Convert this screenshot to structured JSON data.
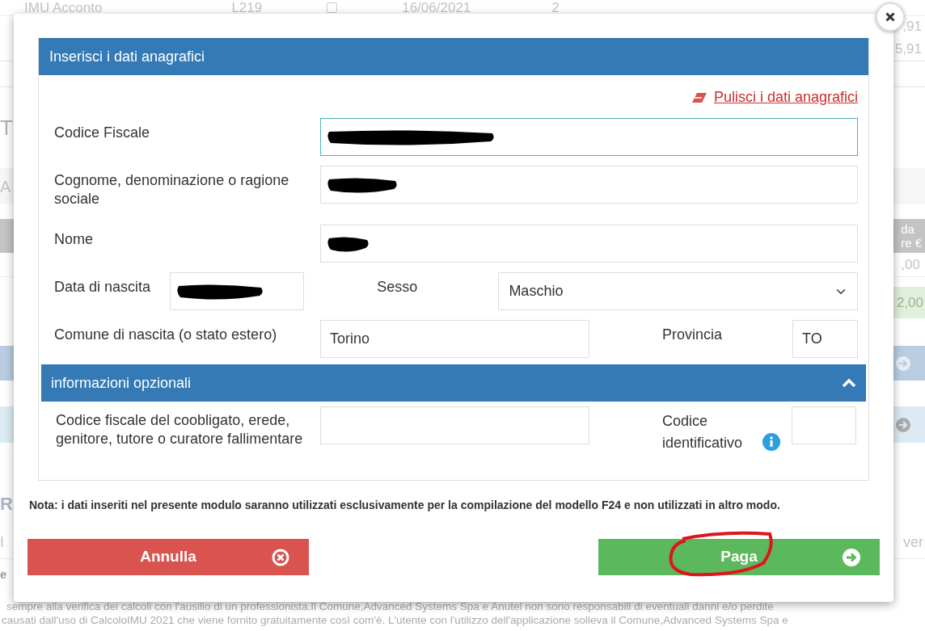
{
  "background": {
    "top_row": {
      "cells": [
        "IMU Acconto",
        "L219",
        "16/06/2021",
        "2"
      ],
      "checked": false
    },
    "right_values": [
      ",91",
      "5,91"
    ],
    "left_fragments": [
      "T",
      "A",
      "R",
      "I",
      "e"
    ],
    "table_header": [
      "da",
      "re €"
    ],
    "row_values": [
      ",00",
      "2,00"
    ],
    "right_text": "ver",
    "disclaimer": [
      "sempre alla verifica dei calcoli con l'ausilio di un professionista.Il Comune,Advanced Systems Spa e Anutel non sono responsabili di eventuali danni e/o perdite",
      "causati dall'uso di CalcoloIMU 2021 che viene fornito gratuitamente così com'è. L'utente con l'utilizzo dell'applicazione solleva il Comune,Advanced Systems Spa e"
    ]
  },
  "dialog": {
    "title": "Inserisci i dati anagrafici",
    "clear_link": "Pulisci i dati anagrafici",
    "fields": [
      {
        "label": "Codice Fiscale",
        "redacted": true,
        "focused": true
      },
      {
        "label": "Cognome, denominazione o ragione sociale",
        "redacted": true,
        "focused": false
      },
      {
        "label": "Nome",
        "redacted": true,
        "focused": false
      }
    ],
    "birth_date": {
      "label": "Data di nascita",
      "redacted": true
    },
    "sex": {
      "label": "Sesso",
      "value": "Maschio"
    },
    "birth_place": {
      "label": "Comune di nascita (o stato estero)",
      "value": "Torino"
    },
    "province": {
      "label": "Provincia",
      "value": "TO"
    },
    "optional_info": {
      "title": "informazioni opzionali",
      "expanded": true,
      "co_obligor": {
        "label": "Codice fiscale del coobligato, erede, genitore, tutore o curatore fallimentare"
      },
      "identifier": {
        "label": "Codice identificativo"
      }
    },
    "note": "Nota: i dati inseriti nel presente modulo saranno utilizzati esclusivamente per la compilazione del modello F24 e non utilizzati in altro modo.",
    "buttons": [
      {
        "label": "Annulla",
        "kind": "cancel",
        "annotated": false
      },
      {
        "label": "Paga",
        "kind": "pay",
        "annotated": true
      }
    ]
  }
}
